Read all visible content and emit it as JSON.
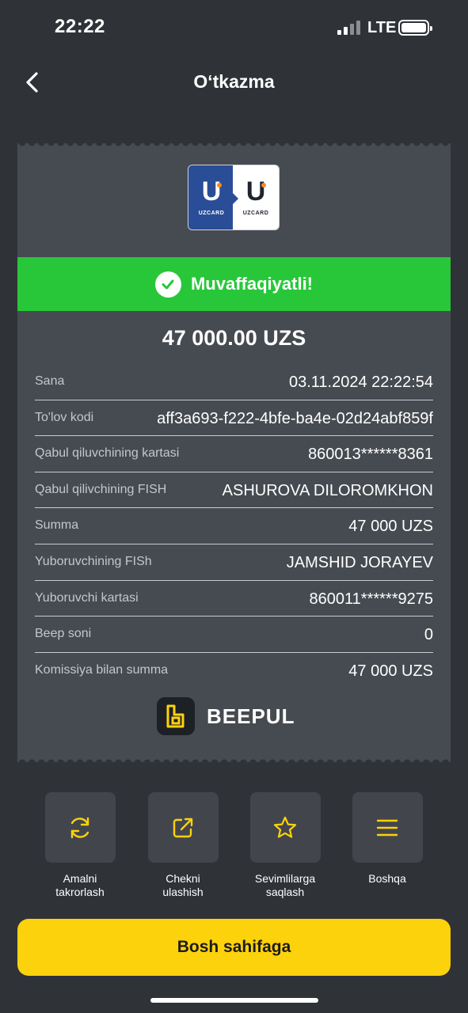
{
  "status_bar": {
    "time": "22:22",
    "network": "LTE"
  },
  "header": {
    "title": "O‘tkazma",
    "back_icon": "chevron-left-icon"
  },
  "receipt": {
    "logo": {
      "left_text": "UZCARD",
      "right_text": "UZCARD",
      "brand_colors": {
        "blue": "#2a4d97",
        "orange": "#f28c28"
      }
    },
    "status_text": "Muvaffaqiyatli!",
    "status_color": "#28c739",
    "amount": "47 000.00 UZS",
    "rows": [
      {
        "label": "Sana",
        "value": "03.11.2024 22:22:54"
      },
      {
        "label": "To'lov kodi",
        "value": "aff3a693-f222-4bfe-ba4e-02d24abf859f"
      },
      {
        "label": "Qabul qiluvchining kartasi",
        "value": "860013******8361"
      },
      {
        "label": "Qabul qilivchining FISH",
        "value": "ASHUROVA DILOROMKHON"
      },
      {
        "label": "Summa",
        "value": "47 000 UZS"
      },
      {
        "label": "Yuboruvchining  FISh",
        "value": "JAMSHID JORAYEV"
      },
      {
        "label": "Yuboruvchi kartasi",
        "value": "860011******9275"
      },
      {
        "label": "Beep soni",
        "value": "0"
      },
      {
        "label": "Komissiya bilan summa",
        "value": "47 000 UZS"
      }
    ],
    "brand": "BEEPUL"
  },
  "actions": [
    {
      "label": "Amalni\ntakrorlash",
      "icon": "refresh-icon"
    },
    {
      "label": "Chekni\nulashish",
      "icon": "share-icon"
    },
    {
      "label": "Sevimlilarga\nsaqlash",
      "icon": "star-icon"
    },
    {
      "label": "Boshqa",
      "icon": "menu-icon"
    }
  ],
  "primary_button": {
    "label": "Bosh sahifaga",
    "color": "#fcd20c"
  },
  "accent_color": "#fcd20c"
}
